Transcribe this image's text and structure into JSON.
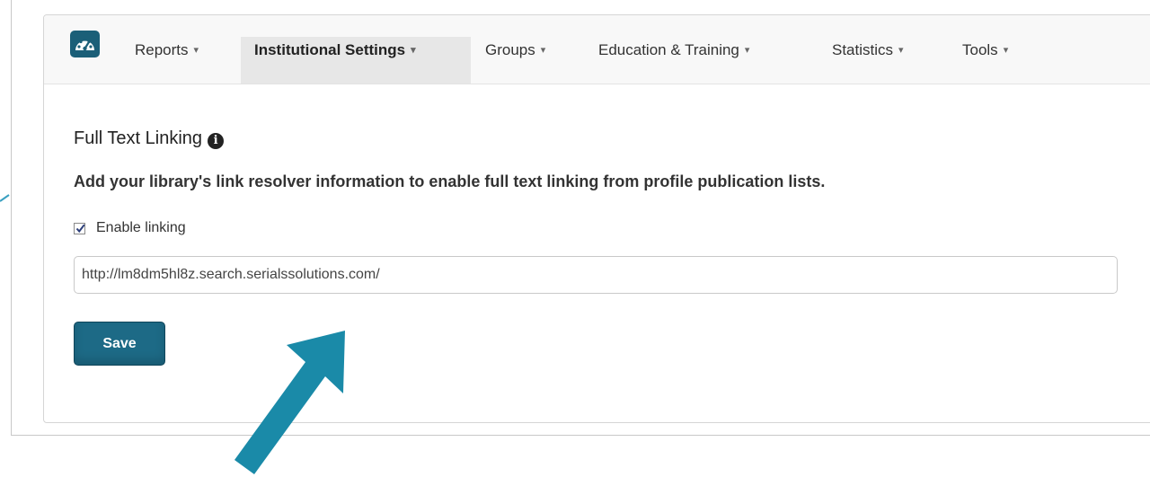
{
  "nav": {
    "items": [
      {
        "label": "Reports"
      },
      {
        "label": "Institutional Settings",
        "active": true
      },
      {
        "label": "Groups"
      },
      {
        "label": "Education & Training"
      },
      {
        "label": "Statistics"
      },
      {
        "label": "Tools"
      }
    ],
    "caret": "▾"
  },
  "logo_icon": "dashboard-icon",
  "section": {
    "title": "Full Text Linking",
    "info_icon": "info-icon",
    "info_glyph": "i",
    "description": "Add your library's link resolver information to enable full text linking from profile publication lists."
  },
  "enable_linking": {
    "label": "Enable linking",
    "checked": true
  },
  "url_field": {
    "value": "http://lm8dm5hl8z.search.serialssolutions.com/",
    "placeholder": ""
  },
  "save_button": {
    "label": "Save"
  },
  "colors": {
    "accent": "#1d6a86",
    "arrow": "#1a8aa8",
    "nav_active_bg": "#e7e7e7"
  }
}
